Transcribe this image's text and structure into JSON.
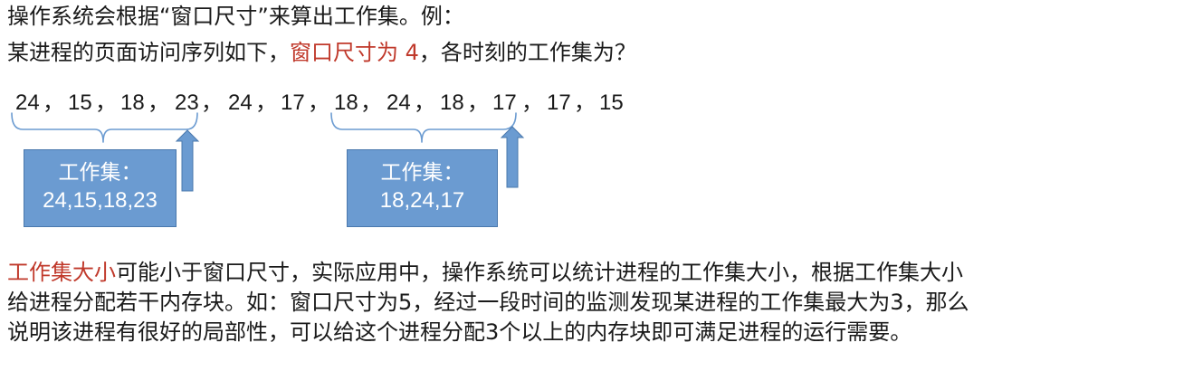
{
  "intro": {
    "line1": "操作系统会根据“窗口尺寸”来算出工作集。例：",
    "line2_before": "某进程的页面访问序列如下，",
    "line2_highlight": "窗口尺寸为 4",
    "line2_after": "，各时刻的工作集为？"
  },
  "sequence": {
    "items": [
      "24",
      "15",
      "18",
      "23",
      "24",
      "17",
      "18",
      "24",
      "18",
      "17",
      "17",
      "15"
    ],
    "separator": "，"
  },
  "working_sets": [
    {
      "label": "工作集：",
      "values": "24,15,18,23"
    },
    {
      "label": "工作集：",
      "values": "18,24,17"
    }
  ],
  "paragraph": {
    "highlight": "工作集大小",
    "line1_rest": "可能小于窗口尺寸，实际应用中，操作系统可以统计进程的工作集大小，根据工作集大小",
    "line2": "给进程分配若干内存块。如：窗口尺寸为5，经过一段时间的监测发现某进程的工作集最大为3，那么",
    "line3": "说明该进程有很好的局部性，可以给这个进程分配3个以上的内存块即可满足进程的运行需要。"
  },
  "colors": {
    "highlight": "#c0392b",
    "box_fill": "#6b9bd1",
    "bracket": "#6b9bd1"
  }
}
